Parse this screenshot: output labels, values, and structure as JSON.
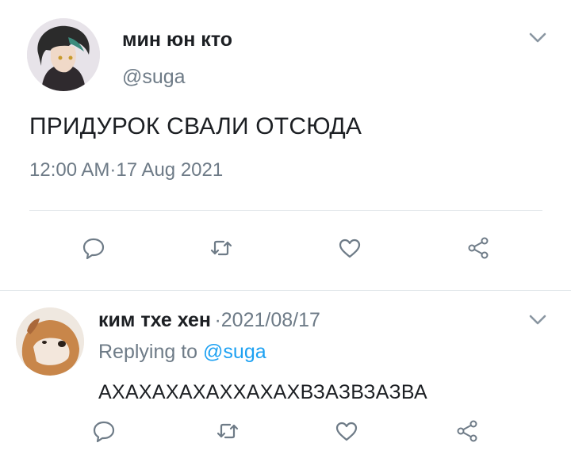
{
  "main_tweet": {
    "display_name": "мин юн кто",
    "handle": "@suga",
    "text": "ПРИДУРОК СВАЛИ ОТСЮДА",
    "time": "12:00 AM",
    "separator": "·",
    "date": "17 Aug 2021",
    "icons": {
      "menu": "chevron-down-icon",
      "reply": "reply-icon",
      "retweet": "retweet-icon",
      "like": "heart-icon",
      "share": "share-icon"
    }
  },
  "reply_tweet": {
    "display_name": "ким тхе хен",
    "separator": "·",
    "date": "2021/08/17",
    "replying_label": "Replying to",
    "replying_handle": "@suga",
    "text": "АХАХАХАХАХХАХАХВЗАЗВЗАЗВА"
  },
  "colors": {
    "text": "#1c1f23",
    "secondary": "#6e7b87",
    "link": "#1da1f2",
    "divider": "#e1e6ea",
    "icon": "#6e7b87"
  }
}
